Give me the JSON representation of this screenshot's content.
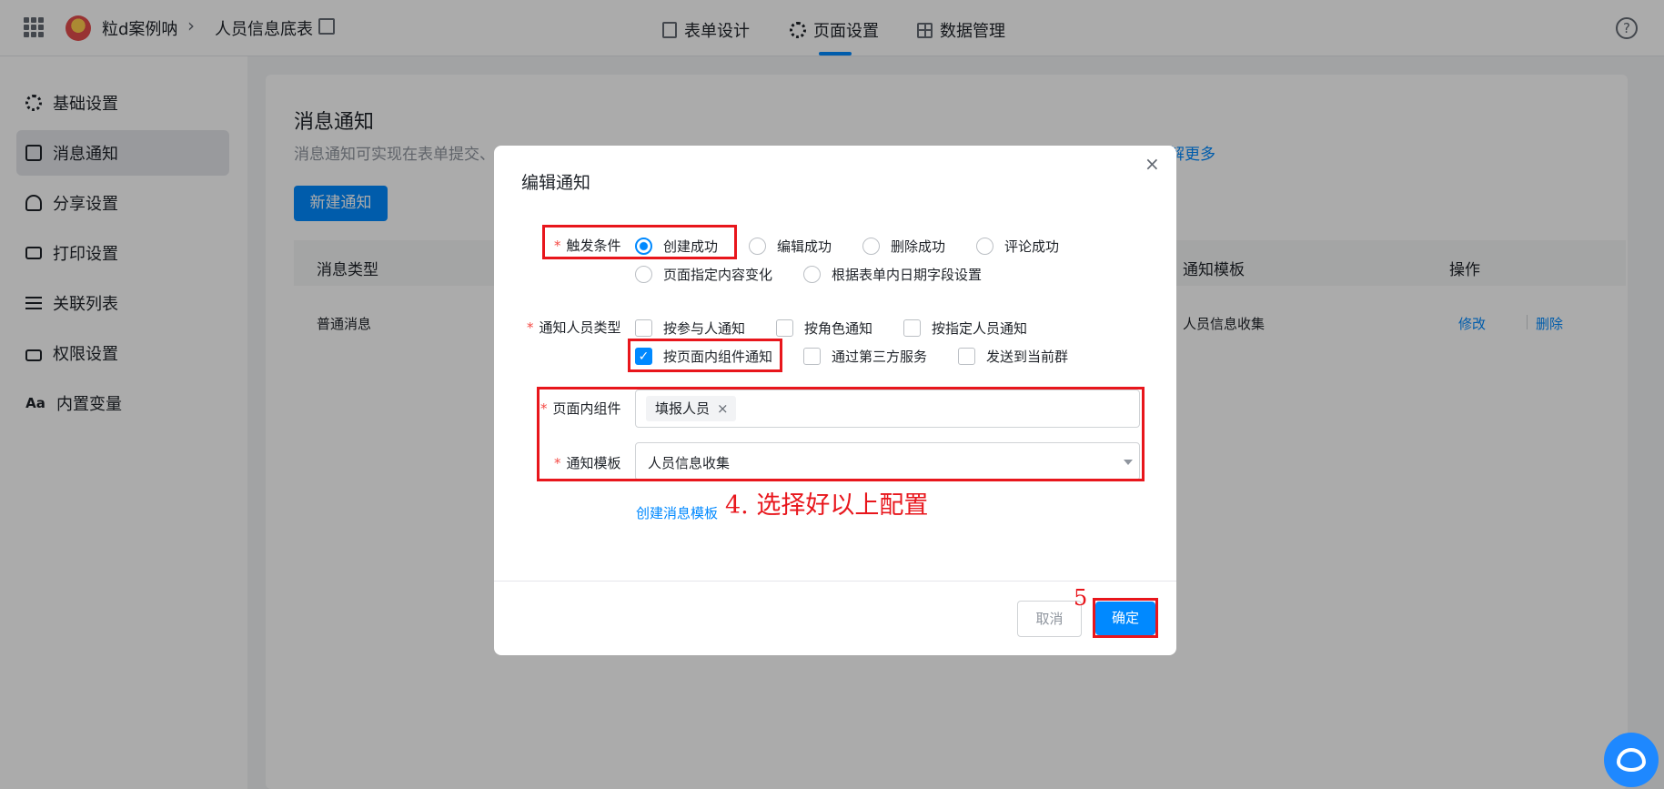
{
  "header": {
    "app_name": "粒d案例呐",
    "breadcrumb_sep": "›",
    "page_name": "人员信息底表",
    "tabs": [
      {
        "label": "表单设计",
        "icon": "form-icon"
      },
      {
        "label": "页面设置",
        "icon": "gear-icon",
        "active": true
      },
      {
        "label": "数据管理",
        "icon": "table-icon"
      }
    ],
    "help_symbol": "?"
  },
  "sidebar": {
    "items": [
      {
        "label": "基础设置",
        "icon": "gear-icon"
      },
      {
        "label": "消息通知",
        "icon": "message-icon",
        "active": true
      },
      {
        "label": "分享设置",
        "icon": "share-icon"
      },
      {
        "label": "打印设置",
        "icon": "printer-icon"
      },
      {
        "label": "关联列表",
        "icon": "list-icon"
      },
      {
        "label": "权限设置",
        "icon": "lock-icon"
      },
      {
        "label": "内置变量",
        "icon": "font-icon",
        "glyph": "Aa"
      }
    ]
  },
  "main": {
    "title": "消息通知",
    "description": "消息通知可实现在表单提交、",
    "learn_more": "了解更多",
    "new_button": "新建通知",
    "table": {
      "headers": [
        "消息类型",
        "通知模板",
        "操作"
      ],
      "rows": [
        {
          "type": "普通消息",
          "template": "人员信息收集",
          "actions": [
            "修改",
            "删除"
          ]
        }
      ]
    }
  },
  "modal": {
    "title": "编辑通知",
    "close": "×",
    "trigger": {
      "label": "触发条件",
      "options": [
        "创建成功",
        "编辑成功",
        "删除成功",
        "评论成功",
        "页面指定内容变化",
        "根据表单内日期字段设置"
      ],
      "selected": "创建成功"
    },
    "recipient_type": {
      "label": "通知人员类型",
      "options": [
        "按参与人通知",
        "按角色通知",
        "按指定人员通知",
        "按页面内组件通知",
        "通过第三方服务",
        "发送到当前群"
      ],
      "checked": [
        "按页面内组件通知"
      ]
    },
    "component": {
      "label": "页面内组件",
      "tags": [
        "填报人员"
      ],
      "tag_remove": "×"
    },
    "template": {
      "label": "通知模板",
      "value": "人员信息收集"
    },
    "create_template_link": "创建消息模板",
    "buttons": {
      "cancel": "取消",
      "ok": "确定"
    },
    "required_mark": "*"
  },
  "annotations": {
    "step4": "4. 选择好以上配置",
    "step5": "5",
    "color": "#e8161c"
  },
  "colors": {
    "primary": "#0089ff",
    "danger": "#f54a45"
  }
}
